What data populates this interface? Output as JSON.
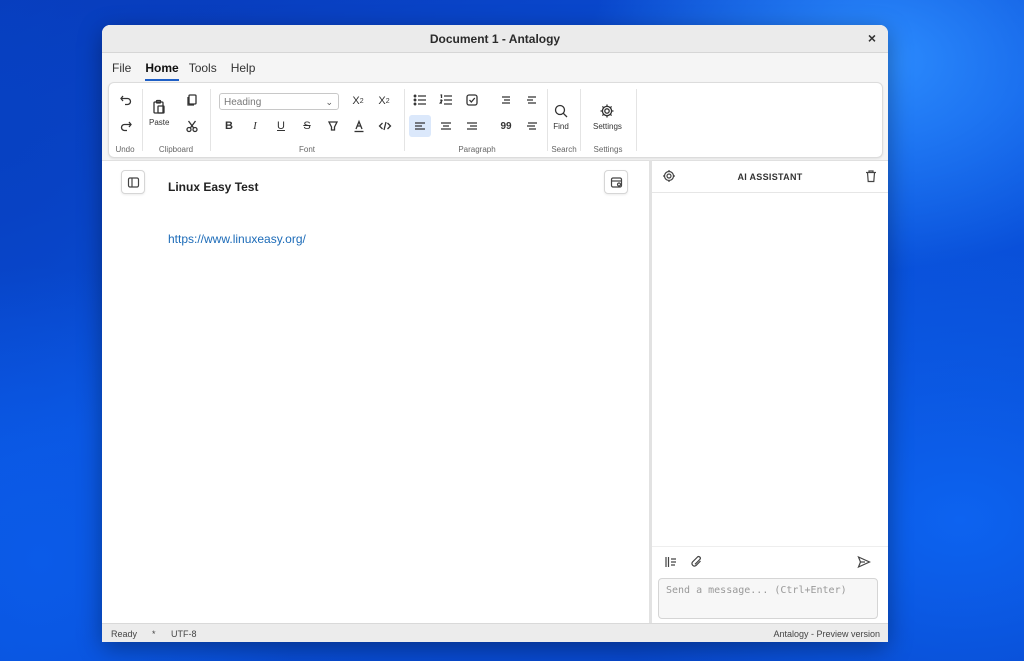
{
  "window": {
    "title": "Document 1 - Antalogy",
    "close_label": "×"
  },
  "menu": [
    "File",
    "Home",
    "Tools",
    "Help"
  ],
  "ribbon": {
    "groups": {
      "undo": "Undo",
      "clipboard": "Clipboard",
      "font": "Font",
      "paragraph": "Paragraph",
      "search": "Search",
      "settings": "Settings"
    },
    "paste_label": "Paste",
    "find_label": "Find",
    "settings_label": "Settings",
    "heading_select": "Heading",
    "bold": "B",
    "italic": "I",
    "underline": "U",
    "strike": "S",
    "quote": "99"
  },
  "document": {
    "heading": "Linux Easy Test",
    "link": "https://www.linuxeasy.org/"
  },
  "assistant": {
    "title": "AI ASSISTANT",
    "input_placeholder": "Send a message... (Ctrl+Enter)"
  },
  "status": {
    "ready": "Ready",
    "modified": "*",
    "encoding": "UTF-8",
    "version": "Antalogy - Preview version"
  },
  "colors": {
    "accent": "#1e5fc6",
    "link": "#1c6bb8",
    "active_btn_bg": "#dbe8fb"
  }
}
